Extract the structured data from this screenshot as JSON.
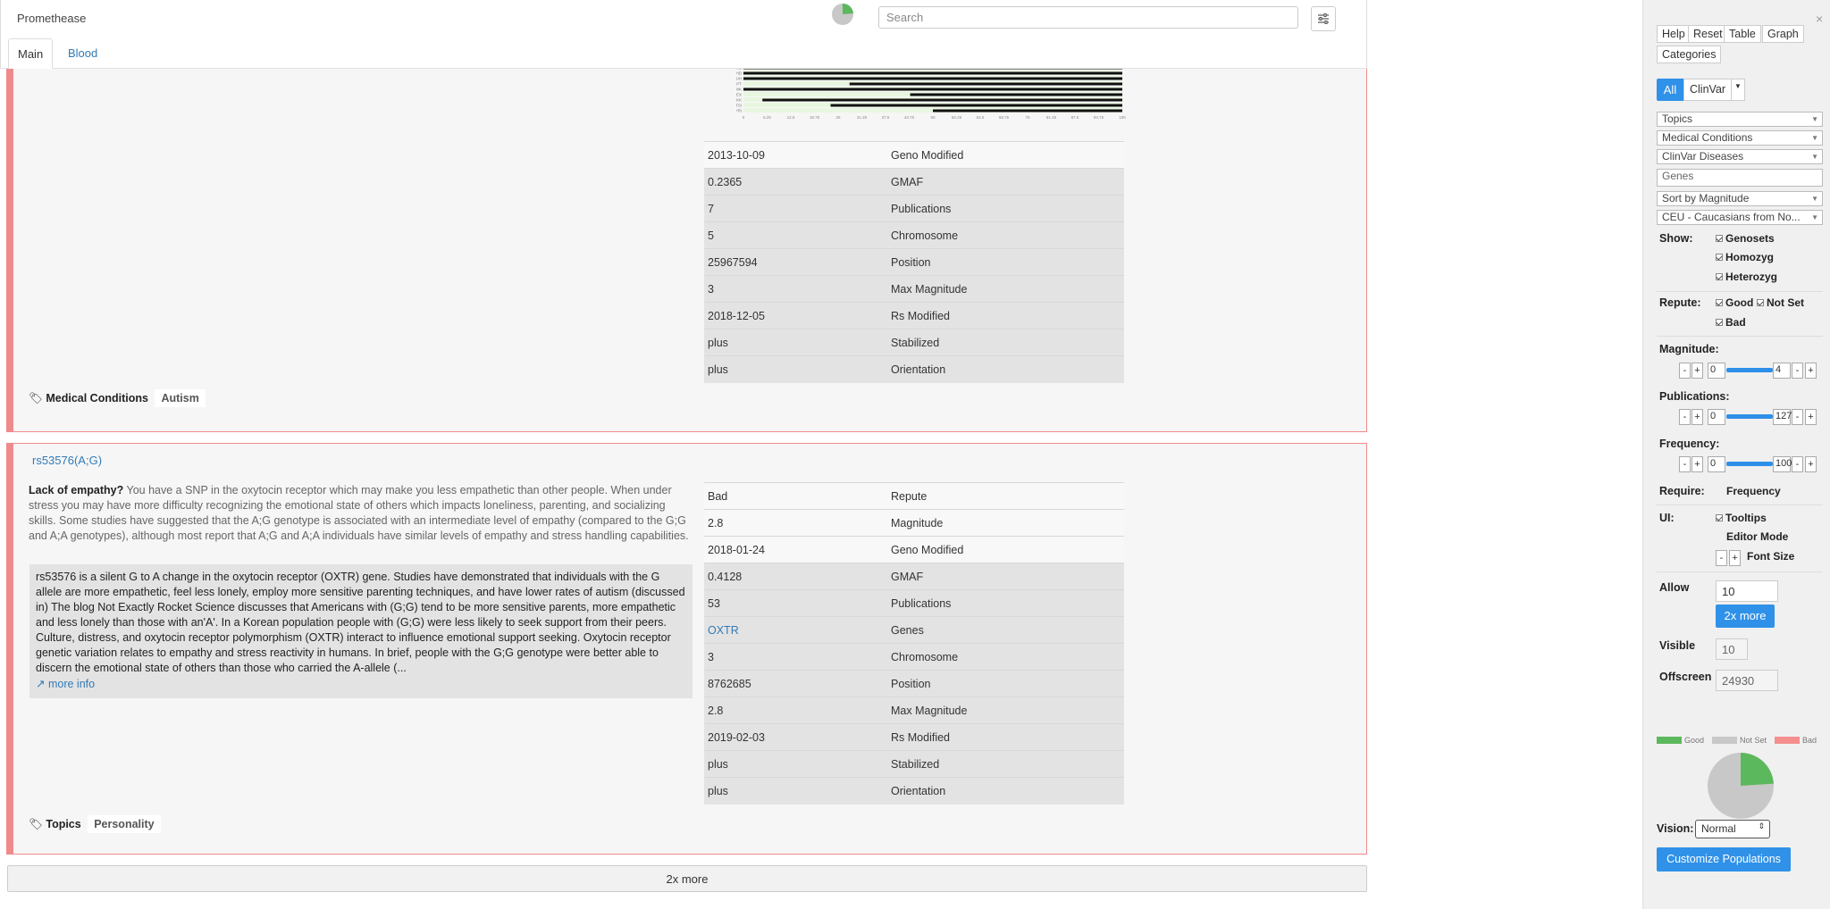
{
  "app": {
    "title": "Promethease"
  },
  "search": {
    "placeholder": "Search"
  },
  "tabs": [
    {
      "label": "Main"
    },
    {
      "label": "Blood"
    }
  ],
  "card1": {
    "rows": [
      {
        "value": "2013-10-09",
        "key": "Geno Modified"
      },
      {
        "value": "0.2365",
        "key": "GMAF"
      },
      {
        "value": "7",
        "key": "Publications"
      },
      {
        "value": "5",
        "key": "Chromosome"
      },
      {
        "value": "25967594",
        "key": "Position"
      },
      {
        "value": "3",
        "key": "Max Magnitude"
      },
      {
        "value": "2018-12-05",
        "key": "Rs Modified"
      },
      {
        "value": "plus",
        "key": "Stabilized"
      },
      {
        "value": "plus",
        "key": "Orientation"
      }
    ],
    "tag_label": "Medical Conditions",
    "tag_value": "Autism",
    "freq_chart": {
      "populations": [
        "CEU",
        "CHB",
        "CHD",
        "GIH",
        "JPT",
        "LWK",
        "MEX",
        "MKK",
        "TSI",
        "YRI"
      ],
      "tick_labels": [
        "0",
        "6.25",
        "12.5",
        "18.75",
        "25",
        "31.25",
        "37.5",
        "43.75",
        "50",
        "56.25",
        "62.5",
        "68.75",
        "75",
        "81.25",
        "87.5",
        "93.75",
        "100"
      ],
      "bar_start_pct": [
        0,
        0,
        0,
        0,
        28,
        0,
        44,
        5,
        23,
        50
      ]
    }
  },
  "card2": {
    "rsid": "rs53576(A;G)",
    "summary_bold": "Lack of empathy?",
    "summary_text": " You have a SNP in the oxytocin receptor which may make you less empathetic than other people. When under stress you may have more difficulty recognizing the emotional state of others which impacts loneliness, parenting, and socializing skills. Some studies have suggested that the A;G genotype is associated with an intermediate level of empathy (compared to the G;G and A;A genotypes), although most report that A;G and A;A individuals have similar levels of empathy and stress handling capabilities.",
    "quote_text": "rs53576 is a silent G to A change in the oxytocin receptor (OXTR) gene. Studies have demonstrated that individuals with the G allele are more empathetic, feel less lonely, employ more sensitive parenting techniques, and have lower rates of autism (discussed in) The blog Not Exactly Rocket Science discusses that Americans with (G;G) tend to be more sensitive parents, more empathetic and less lonely than those with an'A'. In a Korean population people with (G;G) were less likely to seek support from their peers. Culture, distress, and oxytocin receptor polymorphism (OXTR) interact to influence emotional support seeking. Oxytocin receptor genetic variation relates to empathy and stress reactivity in humans. In brief, people with the G;G genotype were better able to discern the emotional state of others than those who carried the A-allele (...",
    "more_info": "more info",
    "rows": [
      {
        "value": "Bad",
        "key": "Repute"
      },
      {
        "value": "2.8",
        "key": "Magnitude"
      },
      {
        "value": "2018-01-24",
        "key": "Geno Modified"
      },
      {
        "value": "0.4128",
        "key": "GMAF"
      },
      {
        "value": "53",
        "key": "Publications"
      },
      {
        "value": "OXTR",
        "key": "Genes"
      },
      {
        "value": "3",
        "key": "Chromosome"
      },
      {
        "value": "8762685",
        "key": "Position"
      },
      {
        "value": "2.8",
        "key": "Max Magnitude"
      },
      {
        "value": "2019-02-03",
        "key": "Rs Modified"
      },
      {
        "value": "plus",
        "key": "Stabilized"
      },
      {
        "value": "plus",
        "key": "Orientation"
      }
    ],
    "tag_label": "Topics",
    "tag_value": "Personality"
  },
  "more_button": "2x more",
  "panel": {
    "close": "×",
    "buttons": [
      "Help",
      "Reset",
      "Table",
      "Graph",
      "Categories"
    ],
    "filter_all": "All",
    "filter_clinvar": "ClinVar",
    "selects": {
      "topics": "Topics",
      "medical": "Medical Conditions",
      "clinvar": "ClinVar Diseases",
      "genes_placeholder": "Genes",
      "sort": "Sort by Magnitude",
      "population": "CEU - Caucasians from No..."
    },
    "show_label": "Show:",
    "show": [
      "Genosets",
      "Homozyg",
      "Heterozyg"
    ],
    "repute_label": "Repute:",
    "repute": [
      "Good",
      "Not Set",
      "Bad"
    ],
    "magnitude": {
      "label": "Magnitude:",
      "min": "0",
      "max": "4"
    },
    "publications": {
      "label": "Publications:",
      "min": "0",
      "max": "127"
    },
    "frequency": {
      "label": "Frequency:",
      "min": "0",
      "max": "100"
    },
    "require_label": "Require:",
    "require_value": "Frequency",
    "ui_label": "UI:",
    "ui_tooltips": "Tooltips",
    "ui_editor": "Editor Mode",
    "ui_font": "Font Size",
    "allow_label": "Allow",
    "allow_value": "10",
    "allow_more": "2x more",
    "visible_label": "Visible",
    "visible_value": "10",
    "offscreen_label": "Offscreen",
    "offscreen_value": "24930",
    "legend": [
      "Good",
      "Not Set",
      "Bad"
    ],
    "colors": {
      "good": "#5cb85c",
      "notset": "#c8c8c8",
      "bad": "#f58e8e"
    },
    "pie": {
      "good_fraction": 0.24,
      "notset_fraction": 0.76
    },
    "vision_label": "Vision:",
    "vision_value": "Normal",
    "customize": "Customize Populations"
  }
}
